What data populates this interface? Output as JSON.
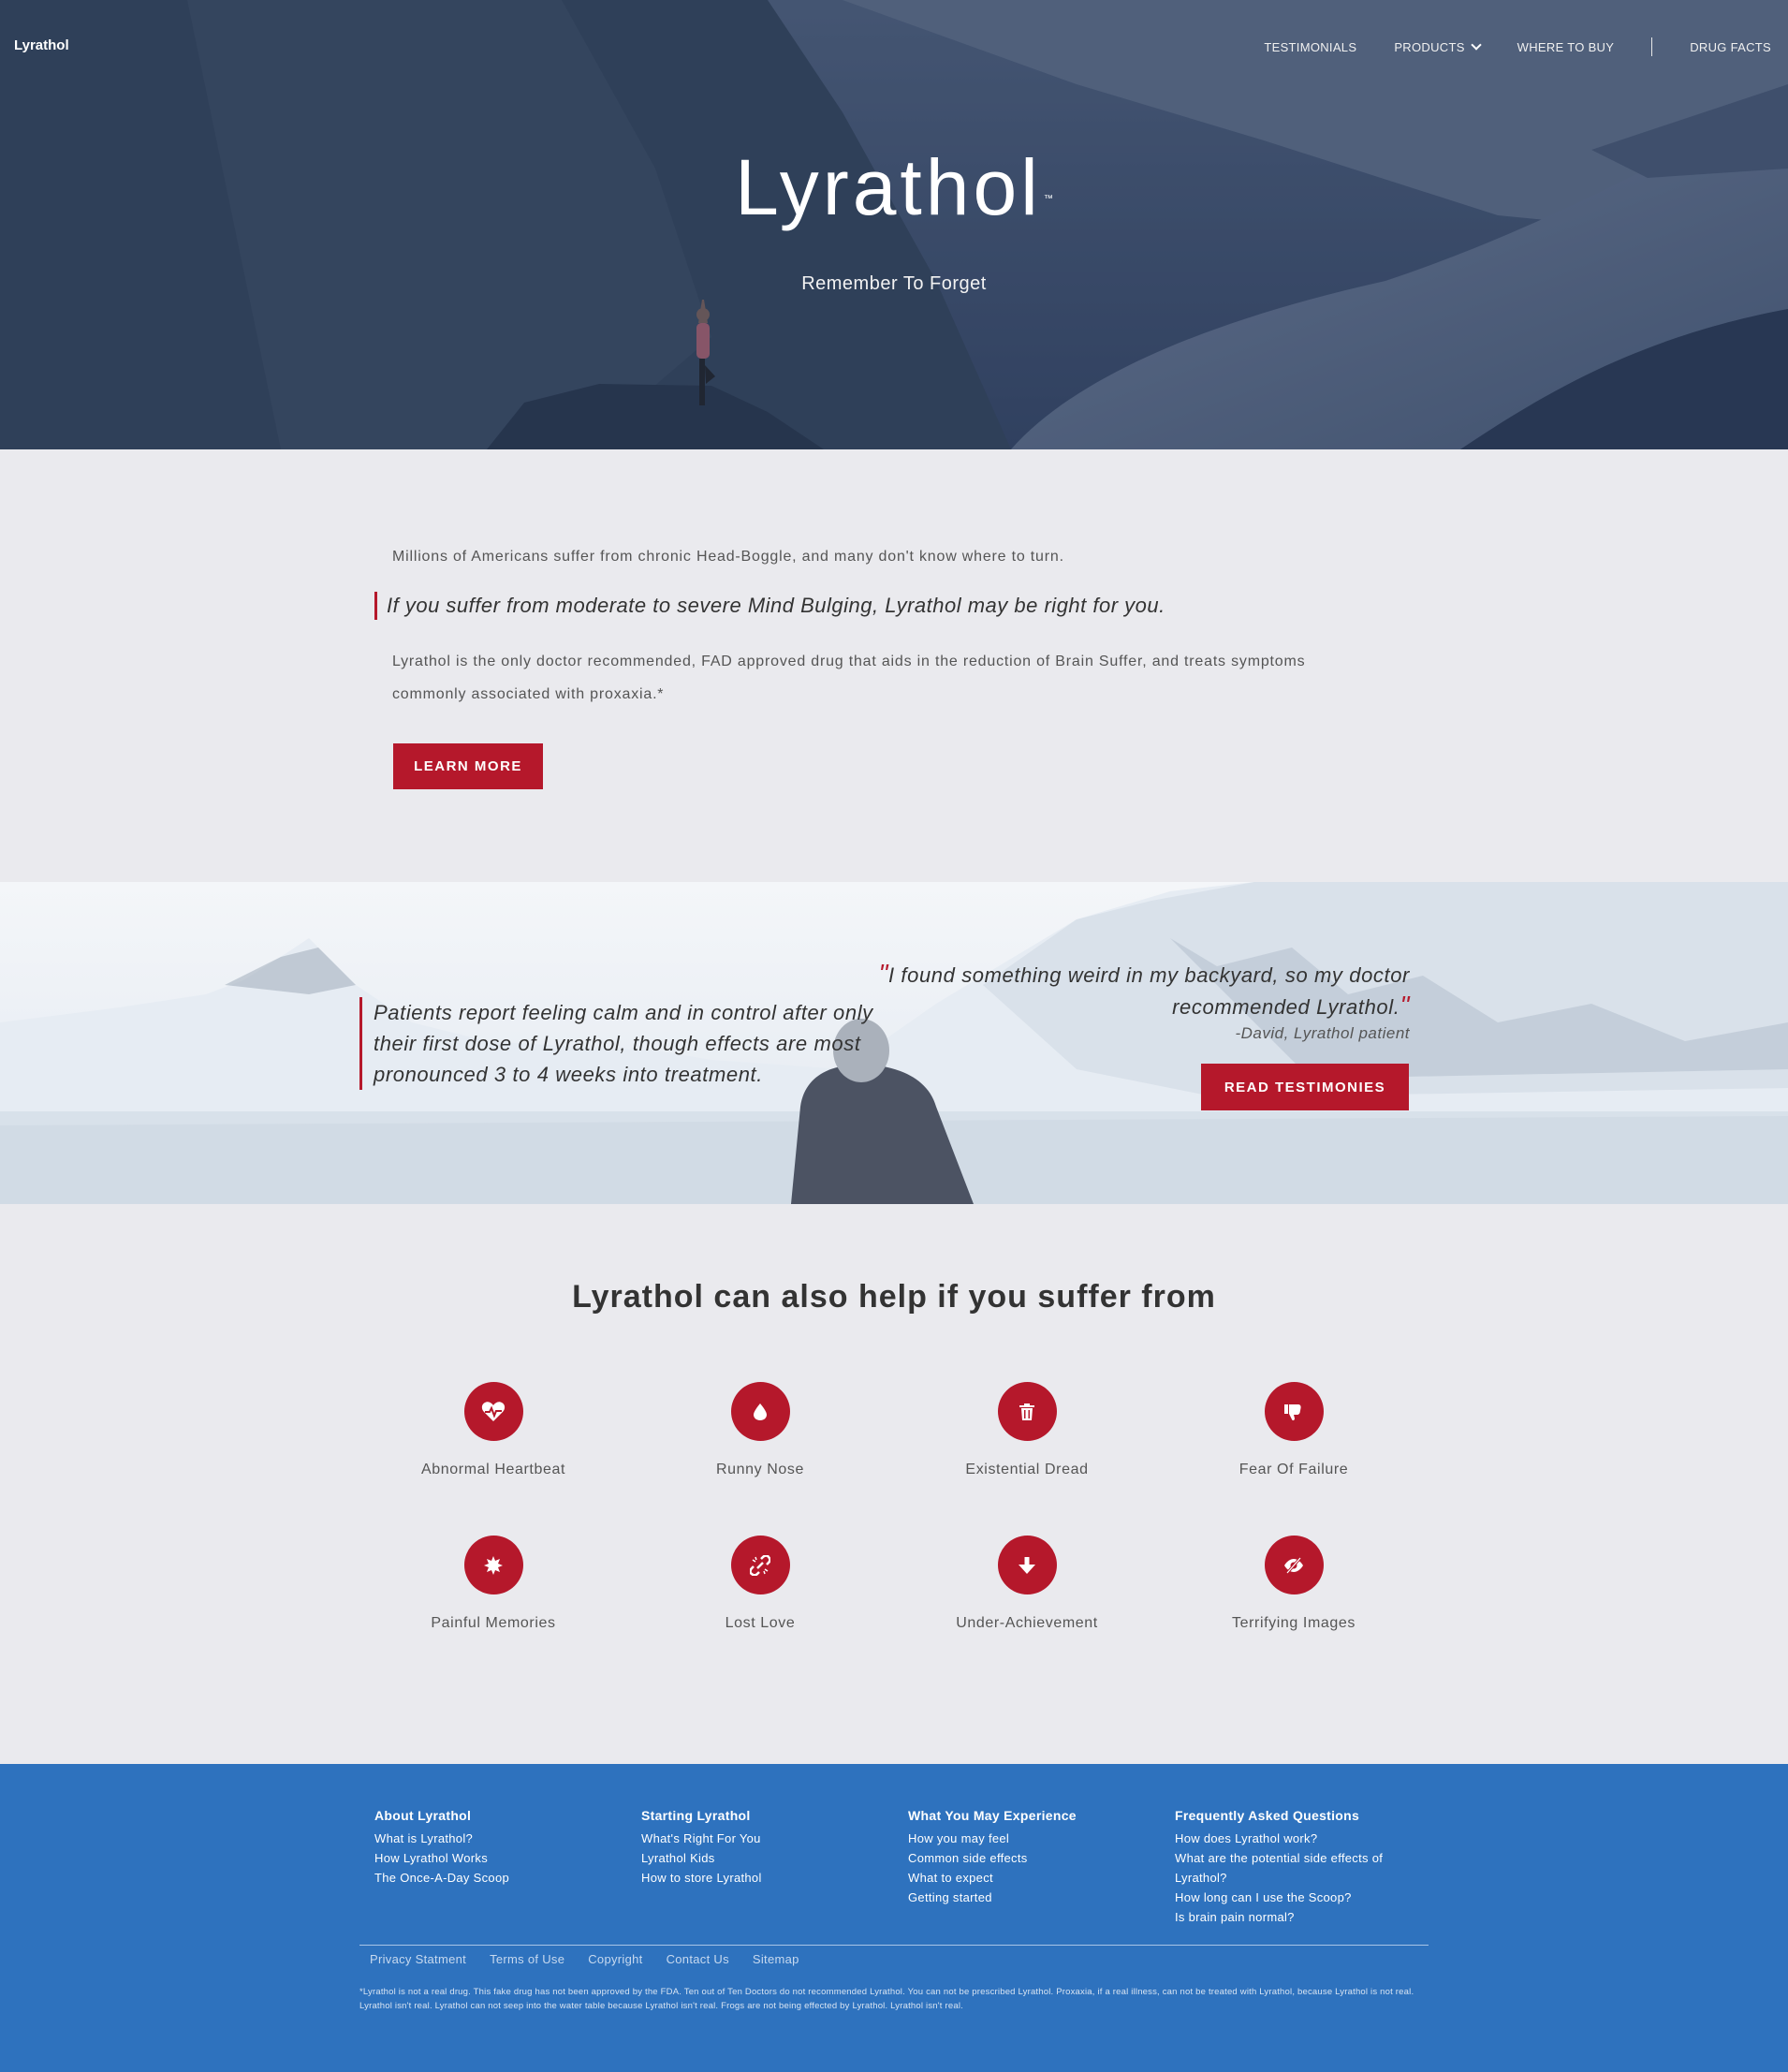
{
  "header": {
    "brand": "Lyrathol",
    "nav": {
      "testimonials": "TESTIMONIALS",
      "products": "PRODUCTS",
      "where_to_buy": "WHERE TO BUY",
      "drug_facts": "DRUG FACTS"
    }
  },
  "hero": {
    "title": "Lyrathol",
    "trademark": "™",
    "subtitle": "Remember To Forget"
  },
  "intro": {
    "paragraph1": "Millions of Americans suffer from chronic Head-Boggle, and many don't know where to turn.",
    "quote": "If you suffer from moderate to severe Mind Bulging, Lyrathol may be right for you.",
    "paragraph2": "Lyrathol is the only doctor recommended, FAD approved drug that aids in the reduction of Brain Suffer, and treats symptoms commonly associated with proxaxia.*",
    "button": "LEARN MORE"
  },
  "banner": {
    "left_quote": "Patients report feeling calm and in control after only their first dose of Lyrathol, though effects are most pronounced 3 to 4 weeks into treatment.",
    "open_mark": "\"",
    "close_mark": "\"",
    "testimonial": "I found something weird in my backyard, so my doctor recommended Lyrathol.",
    "attribution": "-David, Lyrathol patient",
    "button": "READ TESTIMONIES"
  },
  "conditions": {
    "title": "Lyrathol can also help if you suffer from",
    "items": [
      {
        "label": "Abnormal Heartbeat",
        "icon": "heartbeat-icon"
      },
      {
        "label": "Runny Nose",
        "icon": "droplet-icon"
      },
      {
        "label": "Existential Dread",
        "icon": "trash-icon"
      },
      {
        "label": "Fear Of Failure",
        "icon": "thumbs-down-icon"
      },
      {
        "label": "Painful Memories",
        "icon": "burst-icon"
      },
      {
        "label": "Lost Love",
        "icon": "broken-link-icon"
      },
      {
        "label": "Under-Achievement",
        "icon": "arrow-down-icon"
      },
      {
        "label": "Terrifying Images",
        "icon": "eye-slash-icon"
      }
    ],
    "accent_color": "#b5182b"
  },
  "footer": {
    "columns": [
      {
        "title": "About Lyrathol",
        "links": [
          "What is Lyrathol?",
          "How Lyrathol Works",
          "The Once-A-Day Scoop"
        ]
      },
      {
        "title": "Starting Lyrathol",
        "links": [
          "What's Right For You",
          "Lyrathol Kids",
          "How to store Lyrathol"
        ]
      },
      {
        "title": "What You May Experience",
        "links": [
          "How you may feel",
          "Common side effects",
          "What to expect",
          "Getting started"
        ]
      },
      {
        "title": "Frequently Asked Questions",
        "links": [
          "How does Lyrathol work?",
          "What are the potential side effects of Lyrathol?",
          "How long can I use the Scoop?",
          "Is brain pain normal?"
        ]
      }
    ],
    "bottom_links": [
      "Privacy Statment",
      "Terms of Use",
      "Copyright",
      "Contact Us",
      "Sitemap"
    ],
    "disclaimer": "*Lyrathol is not a real drug. This fake drug has not been approved by the FDA. Ten out of Ten Doctors do not recommended Lyrathol. You can not be prescribed Lyrathol. Proxaxia, if a real illness, can not be treated with Lyrathol, because Lyrathol is not real. Lyrathol isn't real. Lyrathol can not seep into the water table because Lyrathol isn't real. Frogs are not being effected by Lyrathol. Lyrathol isn't real.",
    "background_color": "#2e72be"
  }
}
